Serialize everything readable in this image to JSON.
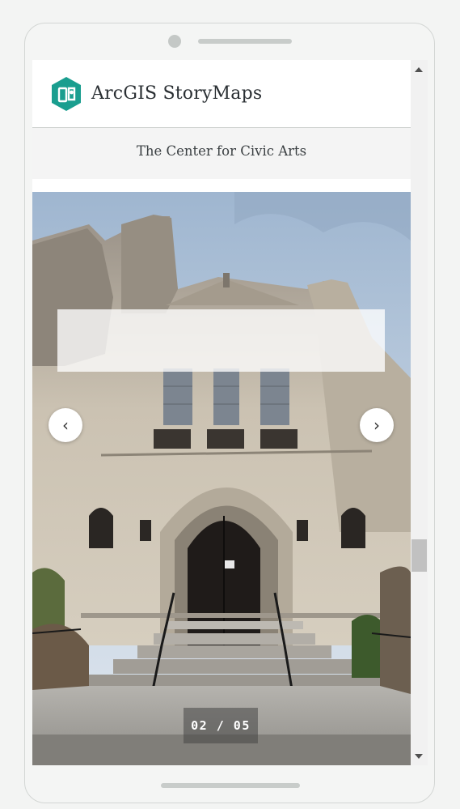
{
  "header": {
    "brand": "ArcGIS StoryMaps",
    "logo_icon": "storymaps-logo-icon",
    "brand_color": "#1a9e8f"
  },
  "story": {
    "title": "The Center for Civic Arts"
  },
  "slideshow": {
    "counter": "02 / 05",
    "prev_icon": "chevron-left-icon",
    "next_icon": "chevron-right-icon",
    "prev_glyph": "‹",
    "next_glyph": "›",
    "current_slide": 2,
    "total_slides": 5
  },
  "colors": {
    "sky": "#b9ccdf",
    "stone": "#cfc6b6",
    "door": "#1f1b19"
  }
}
